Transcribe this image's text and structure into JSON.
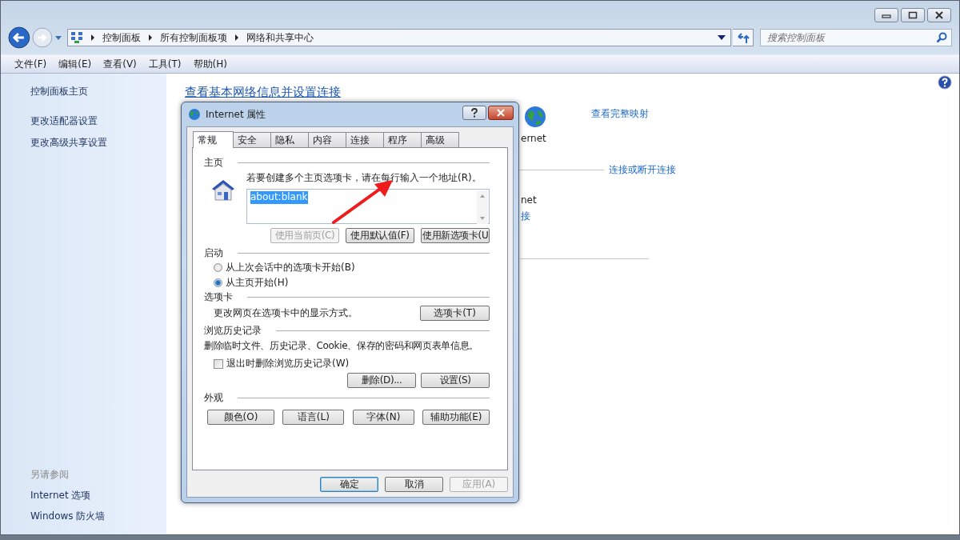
{
  "address_bar": {
    "crumbs": [
      "控制面板",
      "所有控制面板项",
      "网络和共享中心"
    ]
  },
  "search": {
    "placeholder": "搜索控制面板"
  },
  "menu": [
    "文件(F)",
    "编辑(E)",
    "查看(V)",
    "工具(T)",
    "帮助(H)"
  ],
  "sidebar": {
    "links": [
      "控制面板主页",
      "更改适配器设置",
      "更改高级共享设置"
    ],
    "see_also_title": "另请参阅",
    "see_also": [
      "Internet 选项",
      "Windows 防火墙"
    ]
  },
  "main": {
    "title": "查看基本网络信息并设置连接",
    "map_link": "查看完整映射",
    "network_label": "ernet",
    "connect_link": "连接或断开连接",
    "access_label": "net",
    "connection_link": "接"
  },
  "dialog": {
    "title": "Internet 属性",
    "tabs": [
      {
        "label": "常规",
        "selected": true
      },
      {
        "label": "安全",
        "selected": false
      },
      {
        "label": "隐私",
        "selected": false
      },
      {
        "label": "内容",
        "selected": false
      },
      {
        "label": "连接",
        "selected": false
      },
      {
        "label": "程序",
        "selected": false
      },
      {
        "label": "高级",
        "selected": false
      }
    ],
    "home": {
      "heading": "主页",
      "hint": "若要创建多个主页选项卡，请在每行输入一个地址(R)。",
      "value": "about:blank",
      "buttons": [
        {
          "label": "使用当前页(C)",
          "disabled": true
        },
        {
          "label": "使用默认值(F)",
          "disabled": false
        },
        {
          "label": "使用新选项卡(U",
          "disabled": false
        }
      ]
    },
    "startup": {
      "heading": "启动",
      "radios": [
        {
          "label": "从上次会话中的选项卡开始(B)",
          "selected": false
        },
        {
          "label": "从主页开始(H)",
          "selected": true
        }
      ]
    },
    "tabs_section": {
      "heading": "选项卡",
      "text": "更改网页在选项卡中的显示方式。",
      "button": "选项卡(T)"
    },
    "history": {
      "heading": "浏览历史记录",
      "text": "删除临时文件、历史记录、Cookie、保存的密码和网页表单信息。",
      "checkbox": {
        "label": "退出时删除浏览历史记录(W)",
        "checked": false
      },
      "buttons": [
        "删除(D)...",
        "设置(S)"
      ]
    },
    "appearance": {
      "heading": "外观",
      "buttons": [
        "颜色(O)",
        "语言(L)",
        "字体(N)",
        "辅助功能(E)"
      ]
    },
    "footer": [
      {
        "label": "确定",
        "default": true,
        "disabled": false
      },
      {
        "label": "取消",
        "default": false,
        "disabled": false
      },
      {
        "label": "应用(A)",
        "default": false,
        "disabled": true
      }
    ]
  }
}
